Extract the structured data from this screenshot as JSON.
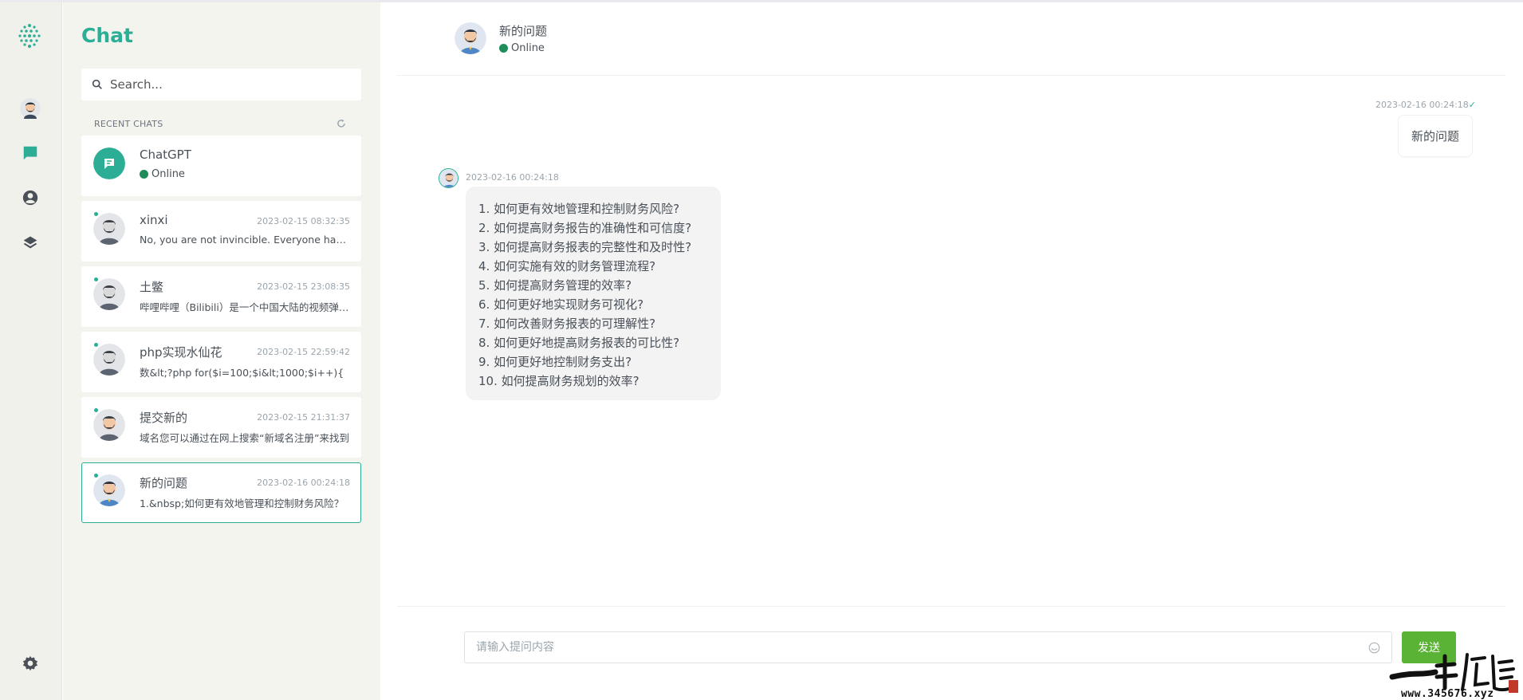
{
  "colors": {
    "accent": "#2bae95",
    "online": "#1e8d5a",
    "send_button": "#5bb335"
  },
  "sidebar": {
    "icons": [
      "app-logo-icon",
      "profile-avatar-icon",
      "chat-icon",
      "user-circle-icon",
      "layers-icon",
      "settings-gear-icon"
    ]
  },
  "panel": {
    "title": "Chat",
    "search_placeholder": "Search...",
    "recent_label": "RECENT CHATS",
    "chats": [
      {
        "name": "ChatGPT",
        "status": "Online",
        "time": "",
        "preview": ""
      },
      {
        "name": "xinxi",
        "time": "2023-02-15 08:32:35",
        "preview": "No, you are not invincible. Everyone has strengths and weaknesses."
      },
      {
        "name": "土鳖",
        "time": "2023-02-15 23:08:35",
        "preview": "哔哩哔哩（Bilibili）是一个中国大陆的视频弹幕网站"
      },
      {
        "name": "php实现水仙花",
        "time": "2023-02-15 22:59:42",
        "preview": "数&lt;?php for($i=100;$i&lt;1000;$i++){"
      },
      {
        "name": "提交新的",
        "time": "2023-02-15 21:31:37",
        "preview": "域名您可以通过在网上搜索“新域名注册”来找到"
      },
      {
        "name": "新的问题",
        "time": "2023-02-16 00:24:18",
        "preview": "1.&nbsp;如何更有效地管理和控制财务风险？"
      }
    ]
  },
  "conversation": {
    "title": "新的问题",
    "status": "Online",
    "sent": {
      "time": "2023-02-16 00:24:18",
      "text": "新的问题"
    },
    "received": {
      "time": "2023-02-16 00:24:18",
      "lines": [
        "1. 如何更有效地管理和控制财务风险?",
        "2. 如何提高财务报告的准确性和可信度?",
        "3. 如何提高财务报表的完整性和及时性?",
        "4. 如何实施有效的财务管理流程?",
        "5. 如何提高财务管理的效率?",
        "6. 如何更好地实现财务可视化?",
        "7. 如何改善财务报表的可理解性?",
        "8. 如何更好地提高财务报表的可比性?",
        "9. 如何更好地控制财务支出?",
        "10. 如何提高财务规划的效率?"
      ]
    },
    "input_placeholder": "请输入提问内容",
    "send_label": "发送"
  },
  "watermark": {
    "url": "www.345676.xyz"
  }
}
